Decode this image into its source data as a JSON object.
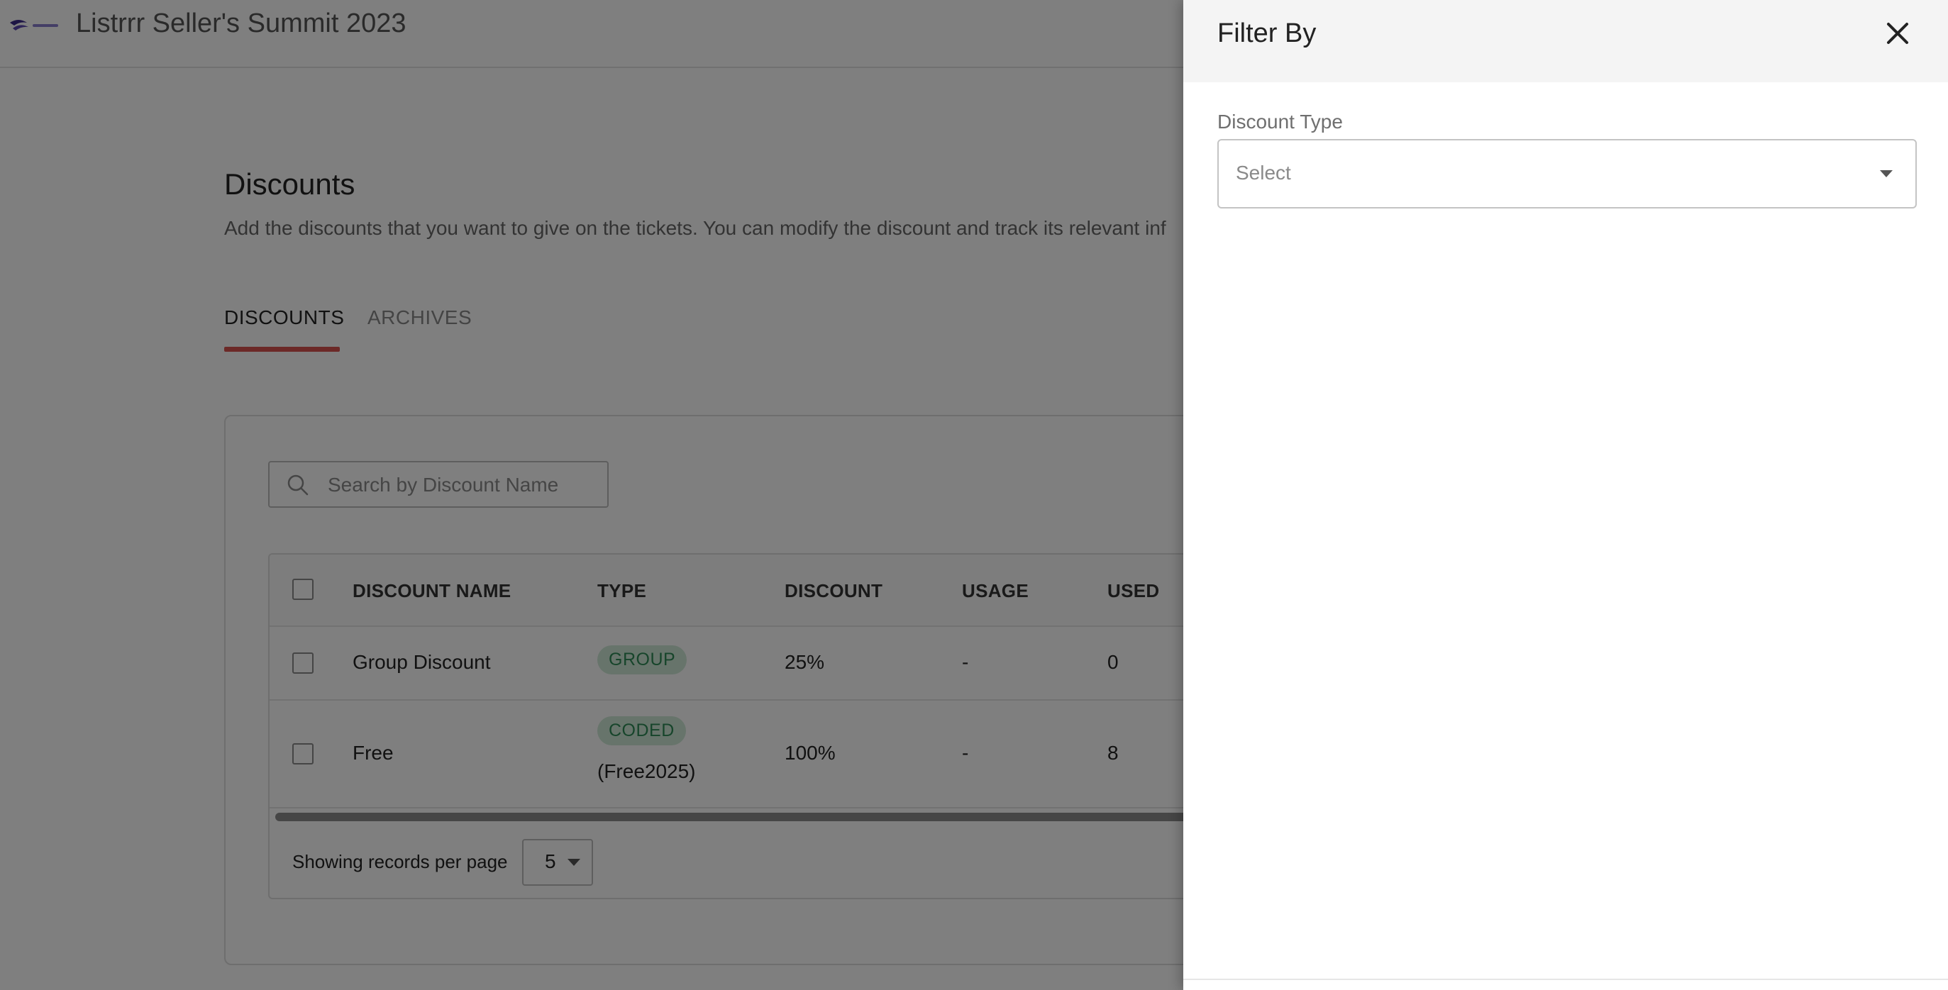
{
  "header": {
    "event_title": "Listrrr Seller's Summit 2023",
    "logo_icon": "listrrr-logo"
  },
  "page": {
    "heading": "Discounts",
    "description": "Add the discounts that you want to give on the tickets. You can modify the discount and track its relevant inf"
  },
  "tabs": [
    {
      "label": "DISCOUNTS",
      "active": true
    },
    {
      "label": "ARCHIVES",
      "active": false
    }
  ],
  "search": {
    "placeholder": "Search by Discount Name",
    "icon": "search-icon"
  },
  "table": {
    "columns": [
      "DISCOUNT NAME",
      "TYPE",
      "DISCOUNT",
      "USAGE",
      "USED"
    ],
    "rows": [
      {
        "name": "Group Discount",
        "type": "GROUP",
        "code": "",
        "discount": "25%",
        "usage": "-",
        "used": "0"
      },
      {
        "name": "Free",
        "type": "CODED",
        "code": "(Free2025)",
        "discount": "100%",
        "usage": "-",
        "used": "8"
      }
    ]
  },
  "pagination": {
    "label": "Showing records per page",
    "per_page": "5"
  },
  "filter_drawer": {
    "title": "Filter By",
    "field_label": "Discount Type",
    "select_value": "Select",
    "close_icon": "close-icon"
  },
  "colors": {
    "tab_accent": "#d9534f",
    "badge_bg": "#cfe9d6",
    "badge_text": "#2e8b57",
    "overlay": "rgba(0,0,0,0.5)"
  }
}
